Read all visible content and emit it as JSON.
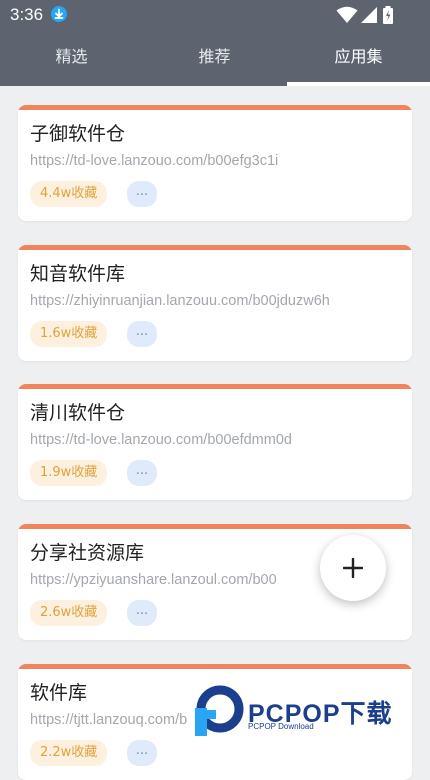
{
  "status_bar": {
    "time": "3:36"
  },
  "tabs": [
    {
      "label": "精选"
    },
    {
      "label": "推荐"
    },
    {
      "label": "应用集"
    }
  ],
  "active_tab": "应用集",
  "cards": [
    {
      "title": "子御软件仓",
      "url": "https://td-love.lanzouo.com/b00efg3c1i",
      "favorites": "4.4w收藏",
      "more": "..."
    },
    {
      "title": "知音软件库",
      "url": "https://zhiyinruanjian.lanzouu.com/b00jduzw6h",
      "favorites": "1.6w收藏",
      "more": "..."
    },
    {
      "title": "清川软件仓",
      "url": "https://td-love.lanzouo.com/b00efdmm0d",
      "favorites": "1.9w收藏",
      "more": "..."
    },
    {
      "title": "分享社资源库",
      "url": "https://ypziyuanshare.lanzoul.com/b00",
      "favorites": "2.6w收藏",
      "more": "..."
    },
    {
      "title": "软件库",
      "url": "https://tjtt.lanzouq.com/b",
      "favorites": "2.2w收藏",
      "more": "..."
    }
  ],
  "fab": {
    "icon": "plus-icon"
  },
  "watermark": {
    "brand": "PCPOP下载",
    "sub": "PCPOP Download"
  },
  "colors": {
    "appbar": "#5d6470",
    "card_strip": "#f0845c",
    "fav_badge_bg": "#fdf0de",
    "fav_badge_text": "#e0a23c",
    "more_badge_bg": "#dfeafb",
    "background": "#eeeff1"
  }
}
